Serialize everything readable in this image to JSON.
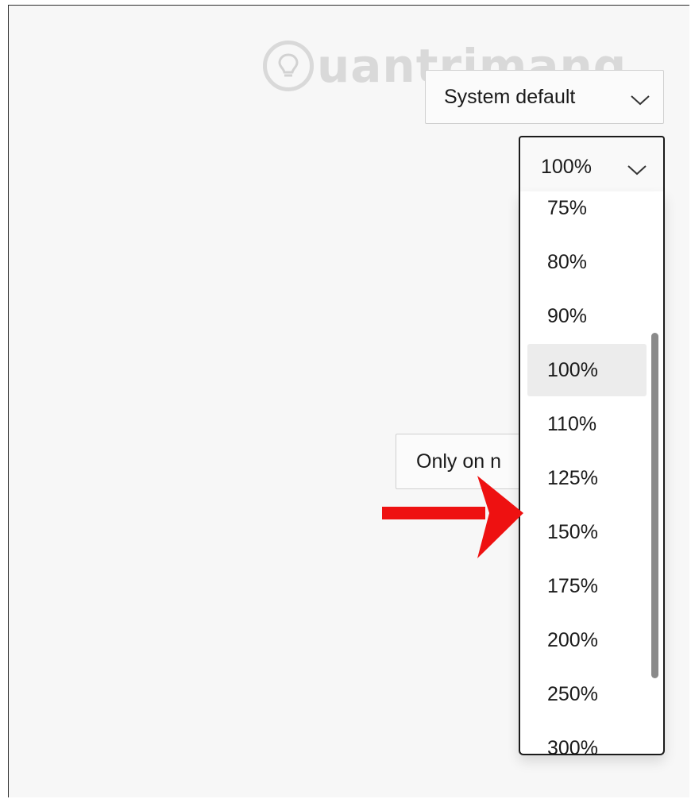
{
  "watermark": {
    "text": "uantrimang"
  },
  "font_select": {
    "value": "System default"
  },
  "zoom_select": {
    "value": "100%"
  },
  "tabs_select": {
    "value": "Only on n"
  },
  "zoom_dropdown": {
    "options": [
      "75%",
      "80%",
      "90%",
      "100%",
      "110%",
      "125%",
      "150%",
      "175%",
      "200%",
      "250%",
      "300%"
    ],
    "selected": "100%"
  },
  "annotation": {
    "arrow_color": "#ee1111",
    "points_to": "150%"
  },
  "colors": {
    "background": "#f7f7f7",
    "dropdown_border": "#1b1b1b",
    "selected_option": "#ececec",
    "scrollbar": "#8a8a8a"
  }
}
